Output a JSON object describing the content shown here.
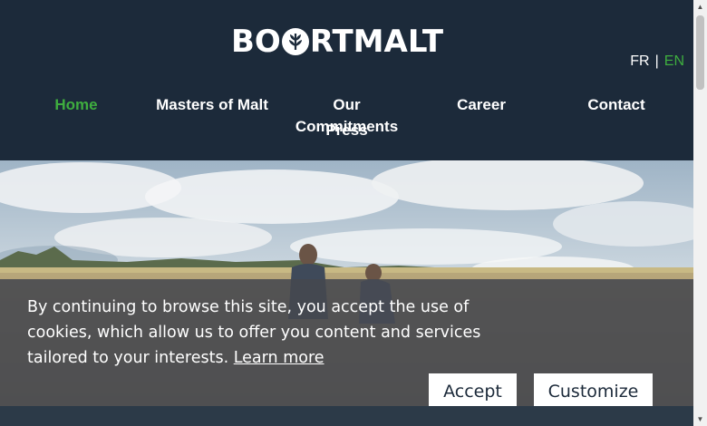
{
  "brand": {
    "logo_pre": "BO",
    "logo_post": "RTMALT",
    "logo_icon": "wheat-in-circle-icon"
  },
  "language": {
    "fr": "FR",
    "separator": "|",
    "en": "EN",
    "active": "EN"
  },
  "nav": {
    "items": [
      {
        "label": "Home",
        "active": true
      },
      {
        "label": "Masters of Malt",
        "active": false
      },
      {
        "label": "Our Commitments",
        "active": false
      },
      {
        "label": "Press",
        "active": false
      },
      {
        "label": "Career",
        "active": false
      },
      {
        "label": "Contact",
        "active": false
      }
    ]
  },
  "cookie": {
    "message": "By continuing to browse this site, you accept the use of cookies, which allow us to offer you content and services tailored to your interests.",
    "learn_more": "Learn more",
    "accept_label": "Accept",
    "customize_label": "Customize"
  },
  "colors": {
    "header_bg": "#1c2a3a",
    "accent_green": "#3fae3f",
    "banner_bg": "#46484e"
  }
}
